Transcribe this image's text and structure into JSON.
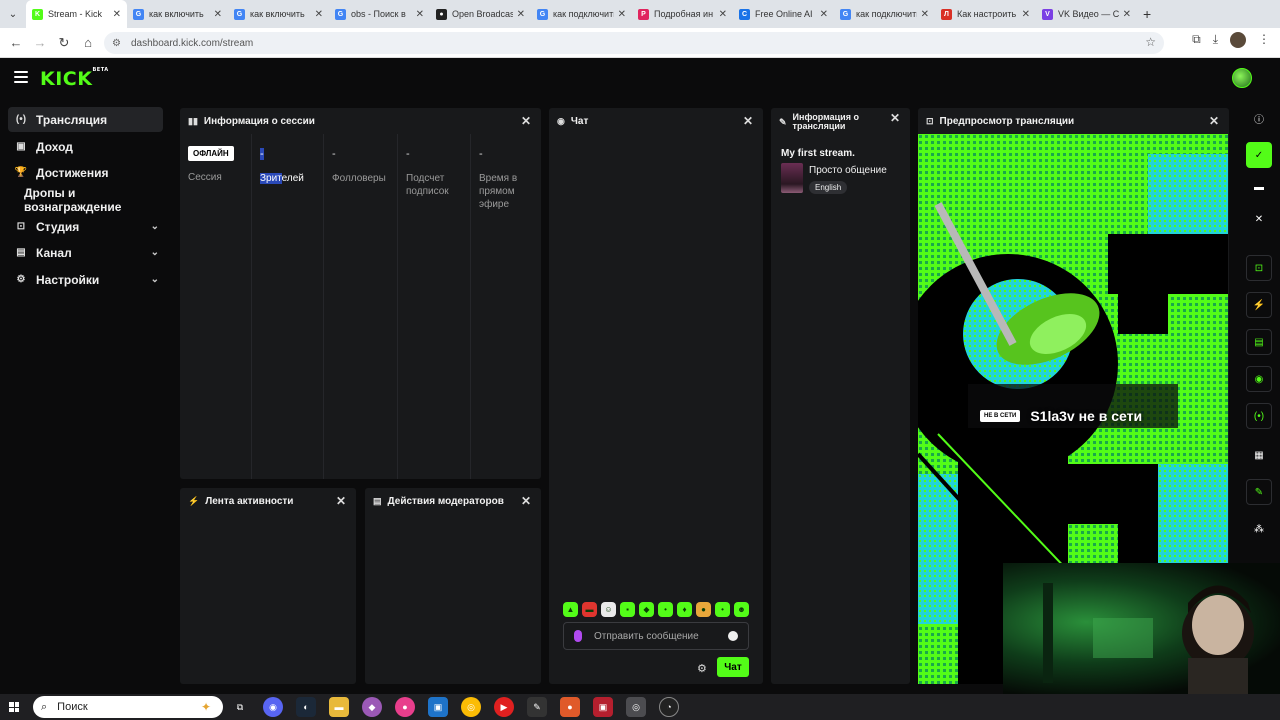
{
  "browser": {
    "tabs": [
      {
        "title": "Stream - Kick",
        "fav": "K",
        "color": "#53fc18",
        "active": true
      },
      {
        "title": "как включить",
        "fav": "G",
        "color": "#4285f4",
        "active": false
      },
      {
        "title": "как включить",
        "fav": "G",
        "color": "#4285f4",
        "active": false
      },
      {
        "title": "obs - Поиск в",
        "fav": "G",
        "color": "#4285f4",
        "active": false
      },
      {
        "title": "Open Broadcast",
        "fav": "●",
        "color": "#222222",
        "active": false
      },
      {
        "title": "как подключить",
        "fav": "G",
        "color": "#4285f4",
        "active": false
      },
      {
        "title": "Подробная ин",
        "fav": "P",
        "color": "#e0245e",
        "active": false
      },
      {
        "title": "Free Online AI",
        "fav": "C",
        "color": "#1a73e8",
        "active": false
      },
      {
        "title": "как подключить",
        "fav": "G",
        "color": "#4285f4",
        "active": false
      },
      {
        "title": "Как настроить",
        "fav": "Л",
        "color": "#d93025",
        "active": false
      },
      {
        "title": "VK Видео — С",
        "fav": "V",
        "color": "#7b3fe4",
        "active": false
      }
    ],
    "url": "dashboard.kick.com/stream"
  },
  "header": {
    "logo": "KICK",
    "beta": "BETA"
  },
  "sidebar": {
    "items": [
      {
        "label": "Трансляция",
        "icon": "(•)"
      },
      {
        "label": "Доход",
        "icon": "▣"
      },
      {
        "label": "Достижения",
        "icon": "🏆"
      },
      {
        "label": "Дропы и вознаграждение",
        "icon": ""
      },
      {
        "label": "Студия",
        "icon": "⊡"
      },
      {
        "label": "Канал",
        "icon": "▤"
      },
      {
        "label": "Настройки",
        "icon": "⚙"
      }
    ]
  },
  "session": {
    "title": "Информация о сессии",
    "offline": "ОФЛАЙН",
    "session_label": "Сессия",
    "viewers_val": "-",
    "viewers_label_sel": "Зрит",
    "viewers_label_rest": "елей",
    "followers_val": "-",
    "followers_label": "Фолловеры",
    "subs_val": "-",
    "subs_label": "Подсчет подписок",
    "time_val": "-",
    "time_label": "Время в прямом эфире"
  },
  "activity": {
    "title": "Лента активности"
  },
  "mod_actions": {
    "title": "Действия модераторов"
  },
  "chat": {
    "title": "Чат",
    "placeholder": "Отправить сообщение",
    "send": "Чат"
  },
  "stream_info": {
    "title": "Информация о трансляции",
    "stream_title": "My first stream.",
    "category": "Просто общение",
    "language": "English"
  },
  "preview": {
    "title": "Предпросмотр трансляции",
    "offline_badge": "НЕ В СЕТИ",
    "offline_text": "S1la3v не в сети"
  },
  "taskbar": {
    "search": "Поиск"
  }
}
